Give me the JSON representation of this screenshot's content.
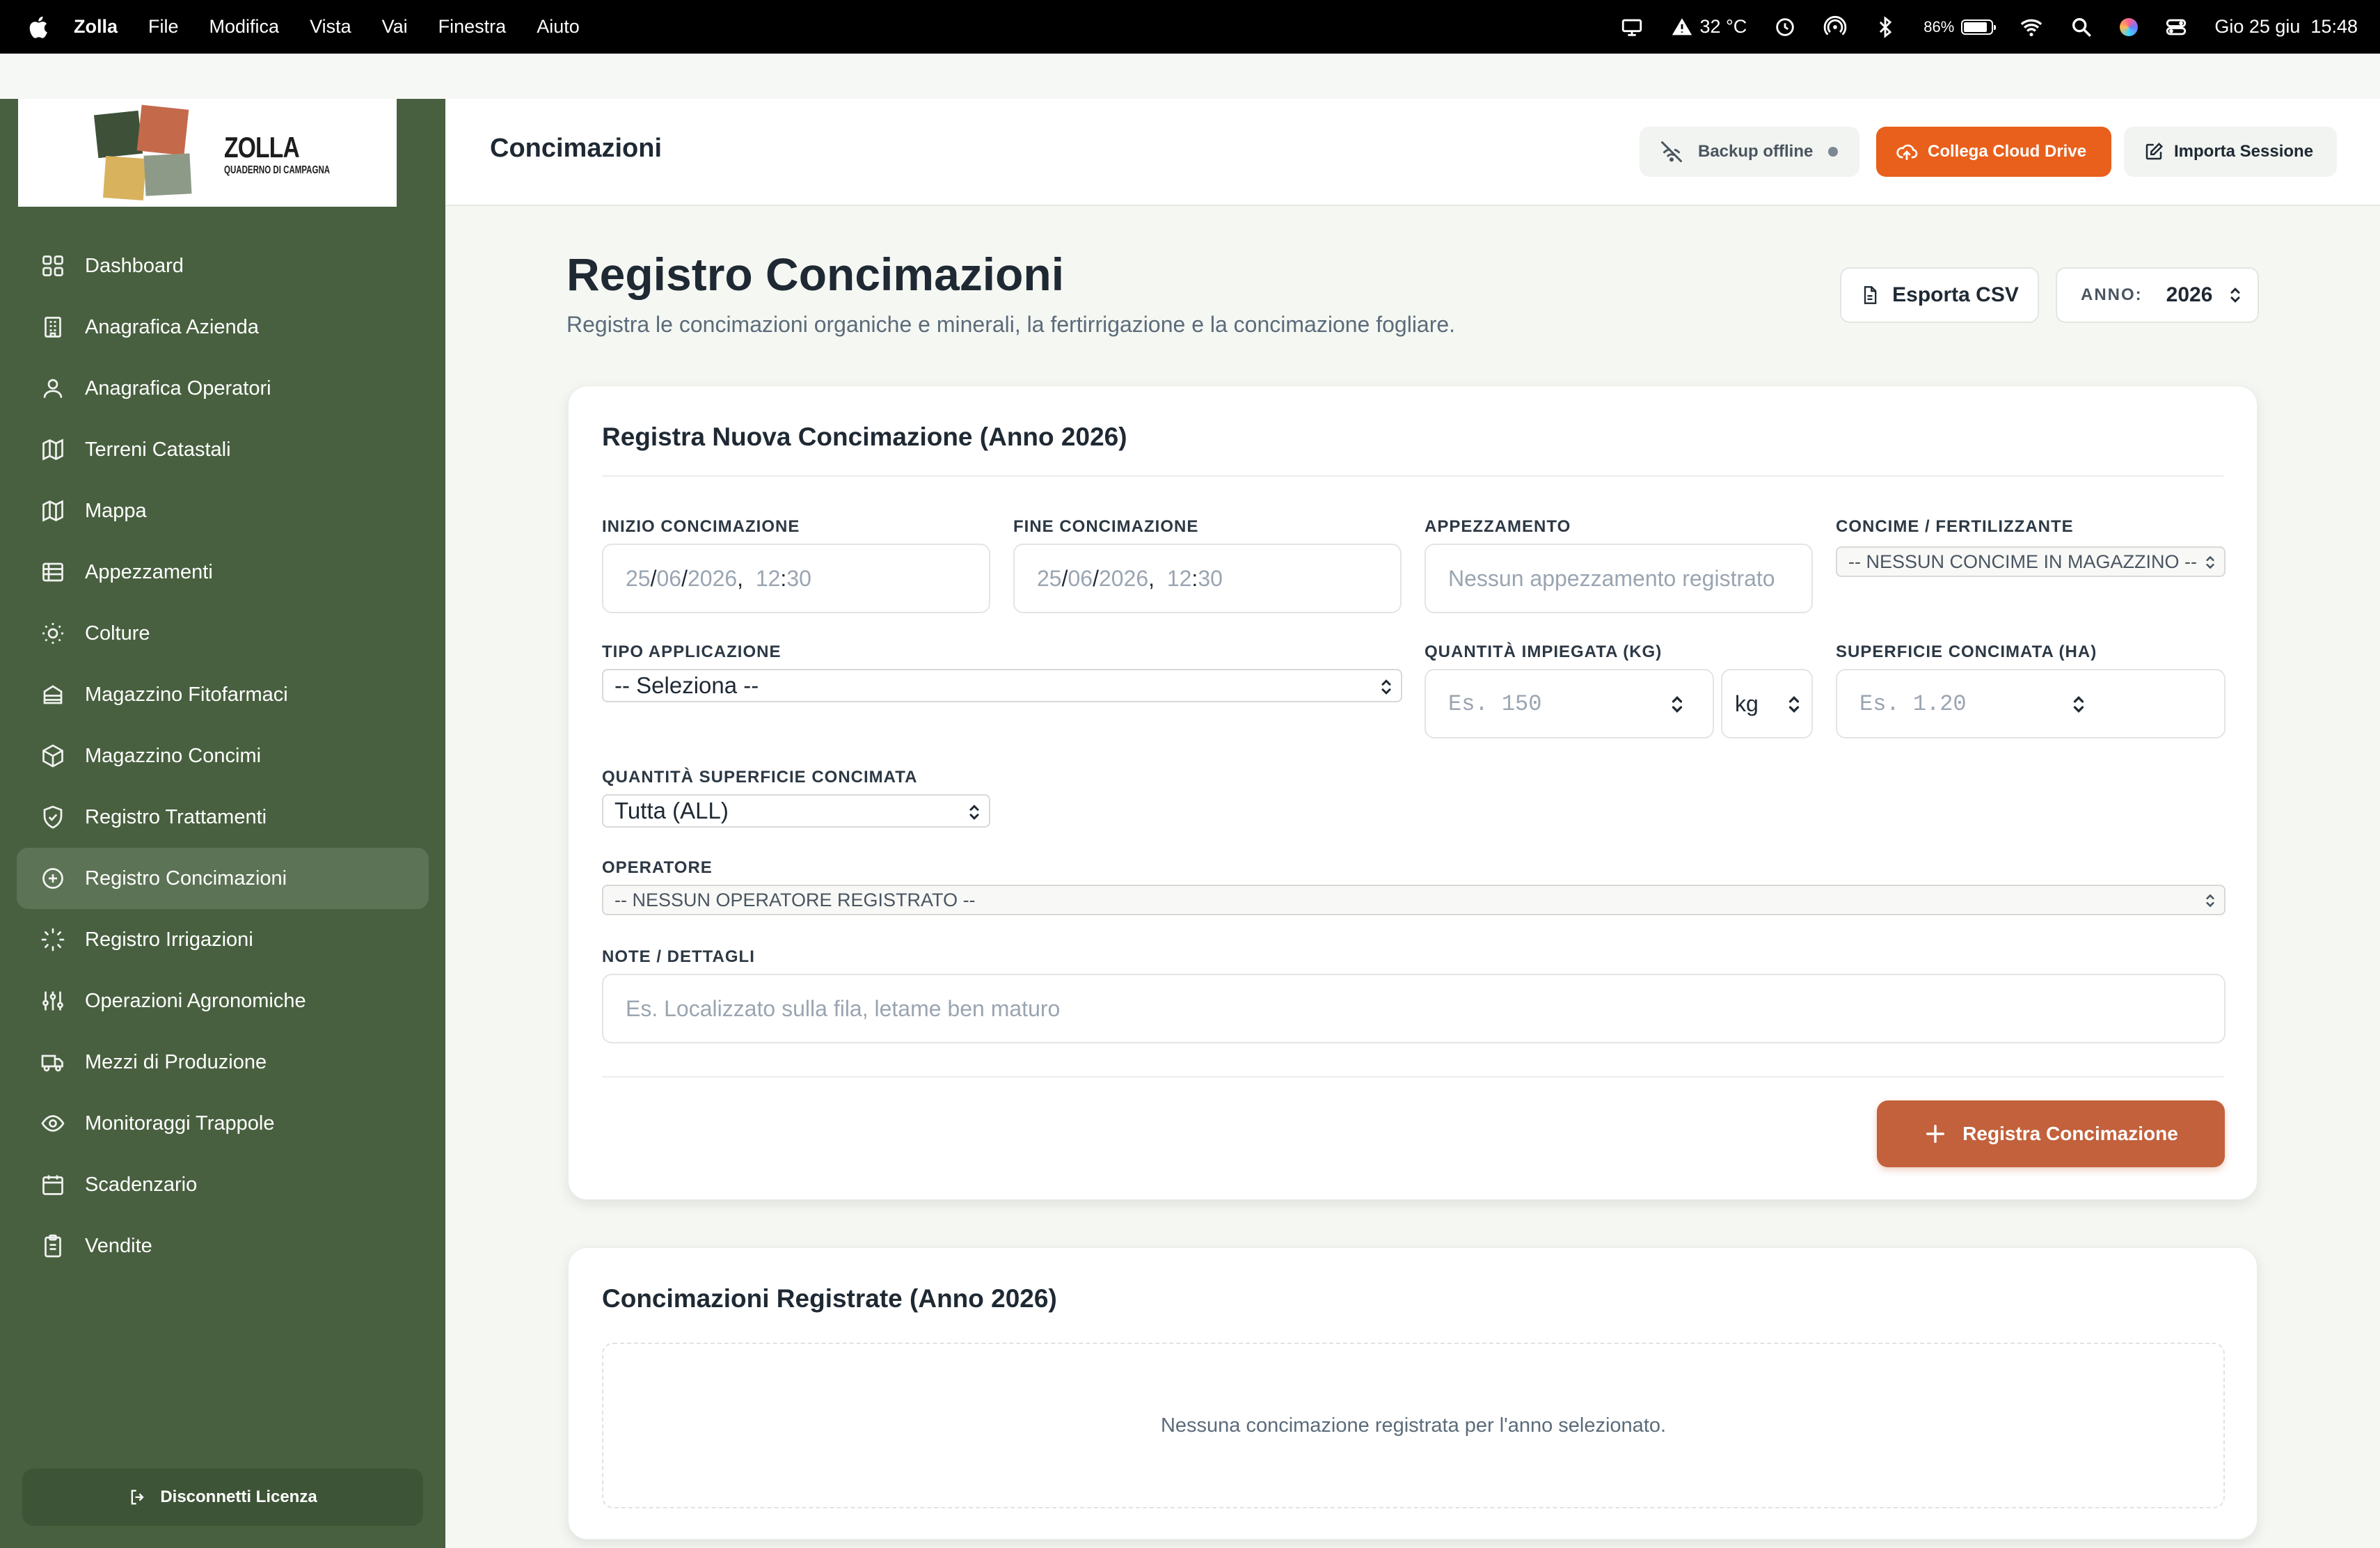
{
  "menubar": {
    "app_name": "Zolla",
    "menus": [
      "File",
      "Modifica",
      "Vista",
      "Vai",
      "Finestra",
      "Aiuto"
    ],
    "weather": "32 °C",
    "battery_percent": "86%",
    "battery_level": 0.86,
    "datetime": "Gio 25 giu  15:48"
  },
  "logo": {
    "title": "ZOLLA",
    "subtitle": "QUADERNO DI CAMPAGNA"
  },
  "sidebar": {
    "items": [
      {
        "label": "Dashboard",
        "icon": "dashboard-icon"
      },
      {
        "label": "Anagrafica Azienda",
        "icon": "building-icon"
      },
      {
        "label": "Anagrafica Operatori",
        "icon": "users-icon"
      },
      {
        "label": "Terreni Catastali",
        "icon": "map-icon"
      },
      {
        "label": "Mappa",
        "icon": "map-icon"
      },
      {
        "label": "Appezzamenti",
        "icon": "grid-icon"
      },
      {
        "label": "Colture",
        "icon": "sun-icon"
      },
      {
        "label": "Magazzino Fitofarmaci",
        "icon": "warehouse-icon"
      },
      {
        "label": "Magazzino Concimi",
        "icon": "box-icon"
      },
      {
        "label": "Registro Trattamenti",
        "icon": "shield-icon"
      },
      {
        "label": "Registro Concimazioni",
        "icon": "plus-circle-icon",
        "active": true
      },
      {
        "label": "Registro Irrigazioni",
        "icon": "loader-icon"
      },
      {
        "label": "Operazioni Agronomiche",
        "icon": "sliders-icon"
      },
      {
        "label": "Mezzi di Produzione",
        "icon": "truck-icon"
      },
      {
        "label": "Monitoraggi Trappole",
        "icon": "eye-icon"
      },
      {
        "label": "Scadenzario",
        "icon": "calendar-icon"
      },
      {
        "label": "Vendite",
        "icon": "clipboard-icon"
      }
    ],
    "logout_label": "Disconnetti Licenza"
  },
  "header": {
    "title": "Concimazioni",
    "backup_label": "Backup offline",
    "cloud_label": "Collega Cloud Drive",
    "import_label": "Importa Sessione"
  },
  "page": {
    "title": "Registro Concimazioni",
    "subtitle": "Registra le concimazioni organiche e minerali, la fertirrigazione e la concimazione fogliare.",
    "export_label": "Esporta CSV",
    "year_label": "ANNO:",
    "year_value": "2026"
  },
  "form": {
    "title": "Registra Nuova Concimazione (Anno 2026)",
    "start": {
      "label": "Inizio Concimazione",
      "day": "25",
      "month": "06",
      "year": "2026",
      "hour": "12",
      "minute": "30"
    },
    "end": {
      "label": "Fine Concimazione",
      "day": "25",
      "month": "06",
      "year": "2026",
      "hour": "12",
      "minute": "30"
    },
    "plot": {
      "label": "Appezzamento",
      "placeholder": "Nessun appezzamento registrato"
    },
    "fertilizer": {
      "label": "Concime / Fertilizzante",
      "value": "-- NESSUN CONCIME IN MAGAZZINO --"
    },
    "application_type": {
      "label": "Tipo Applicazione",
      "value": "-- Seleziona --"
    },
    "quantity": {
      "label": "Quantità Impiegata (KG)",
      "placeholder": "Es. 150",
      "unit": "kg"
    },
    "surface": {
      "label": "Superficie Concimata (HA)",
      "placeholder": "Es. 1.20"
    },
    "surface_qty": {
      "label": "Quantità Superficie Concimata",
      "value": "Tutta (ALL)"
    },
    "operator": {
      "label": "Operatore",
      "value": "-- NESSUN OPERATORE REGISTRATO --"
    },
    "notes": {
      "label": "Note / Dettagli",
      "placeholder": "Es. Localizzato sulla fila, letame ben maturo"
    },
    "submit_label": "Registra Concimazione"
  },
  "list": {
    "title": "Concimazioni Registrate (Anno 2026)",
    "empty_message": "Nessuna concimazione registrata per l'anno selezionato."
  },
  "colors": {
    "sidebar": "#48603f",
    "accent_orange": "#e8601c",
    "submit": "#c2613c"
  }
}
